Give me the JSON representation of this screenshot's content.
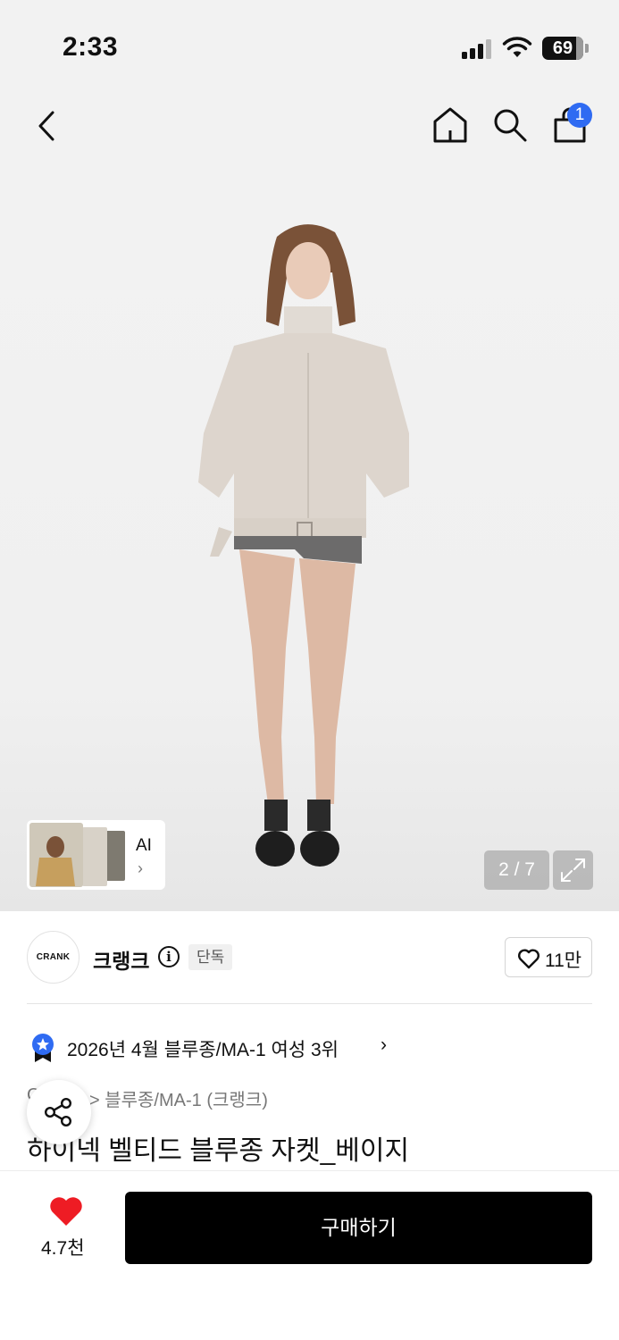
{
  "status_bar": {
    "time": "2:33",
    "battery": "69",
    "icons": [
      "signal-icon",
      "wifi-icon",
      "battery-icon"
    ]
  },
  "nav": {
    "icons": [
      "back-icon",
      "home-icon",
      "search-icon",
      "cart-icon"
    ],
    "cart_badge": "1"
  },
  "gallery": {
    "ai_label": "AI",
    "ai_chevron": "›",
    "counter": "2 / 7",
    "icons": [
      "expand-icon"
    ]
  },
  "brand": {
    "logo_text": "CRANK",
    "name": "크랭크",
    "info_glyph": "i",
    "exclusive": "단독",
    "like_count": "11만"
  },
  "ranking": {
    "text": "2026년 4월 블루종/MA-1 여성 3위",
    "chevron": "›"
  },
  "breadcrumb": {
    "hidden_prefix": "C",
    "text": "> 블루종/MA-1 (크랭크)"
  },
  "product": {
    "title": "하이넥 벨티드 블루종 자켓_베이지"
  },
  "bottom": {
    "wish_count": "4.7천",
    "buy_label": "구매하기",
    "heart_color": "#ee1c24"
  },
  "colors": {
    "accent_blue": "#2f6bf2",
    "buy_button": "#000000"
  }
}
